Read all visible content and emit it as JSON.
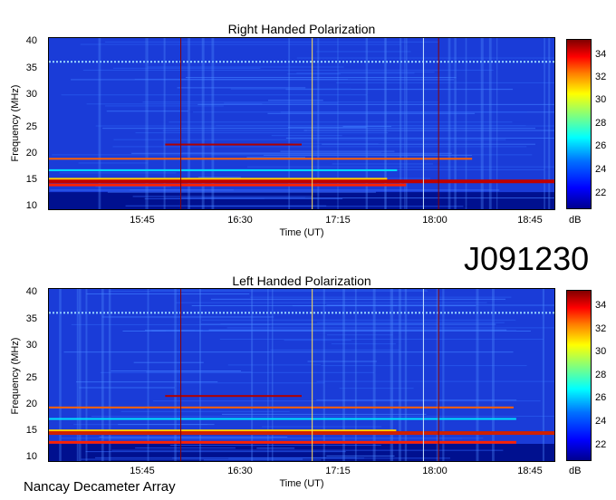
{
  "event_id": "J091230",
  "footer": "Nancay Decameter Array",
  "colors": {
    "background": "#00008f",
    "accent": "#ff0000"
  },
  "chart_data": [
    {
      "type": "heatmap",
      "title": "Right Handed Polarization",
      "xlabel": "Time (UT)",
      "ylabel": "Frequency (MHz)",
      "x_ticks": [
        "15:45",
        "16:30",
        "17:15",
        "18:00",
        "18:45"
      ],
      "y_ticks": [
        "10",
        "15",
        "20",
        "25",
        "30",
        "35",
        "40"
      ],
      "ylim": [
        10,
        40
      ],
      "colorbar": {
        "label": "dB",
        "ticks": [
          "22",
          "24",
          "26",
          "28",
          "30",
          "32",
          "34"
        ]
      },
      "emission_bands_mhz": [
        14.5,
        15.5,
        17.0,
        19.0,
        21.5
      ]
    },
    {
      "type": "heatmap",
      "title": "Left Handed Polarization",
      "xlabel": "Time (UT)",
      "ylabel": "Frequency (MHz)",
      "x_ticks": [
        "15:45",
        "16:30",
        "17:15",
        "18:00",
        "18:45"
      ],
      "y_ticks": [
        "10",
        "15",
        "20",
        "25",
        "30",
        "35",
        "40"
      ],
      "ylim": [
        10,
        40
      ],
      "colorbar": {
        "label": "dB",
        "ticks": [
          "22",
          "24",
          "26",
          "28",
          "30",
          "32",
          "34"
        ]
      },
      "emission_bands_mhz": [
        13.5,
        15.5,
        17.5,
        19.5,
        21.5
      ]
    }
  ]
}
